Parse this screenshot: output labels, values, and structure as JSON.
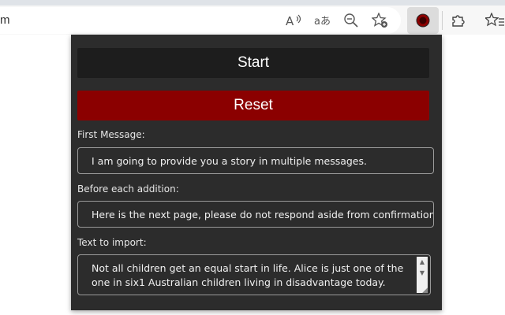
{
  "browser": {
    "address_text": "m",
    "icons": [
      "read-aloud-icon",
      "translate-icon",
      "zoom-out-icon",
      "add-favorite-icon",
      "extension-icon",
      "extensions-puzzle-icon",
      "favorites-icon"
    ]
  },
  "popup": {
    "start_label": "Start",
    "reset_label": "Reset",
    "first_message_label": "First Message:",
    "first_message_value": "I am going to provide you a story in multiple messages.",
    "before_each_label": "Before each addition:",
    "before_each_value": "Here is the next page, please do not respond aside from confirmation:",
    "import_label": "Text to import:",
    "import_value": "Not all children get an equal start in life. Alice is just one of the one in six1 Australian children living in disadvantage today."
  },
  "colors": {
    "popup_bg": "#2c2c2c",
    "start_bg": "#1d1d1d",
    "reset_bg": "#8b0000",
    "field_border": "#9a9a9a"
  }
}
